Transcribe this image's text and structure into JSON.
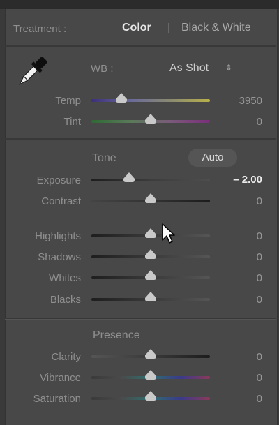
{
  "treatment": {
    "label": "Treatment :",
    "color": "Color",
    "separator": "|",
    "bw": "Black & White"
  },
  "wb": {
    "label": "WB :",
    "value": "As Shot",
    "arrow": "⇕",
    "picker_icon": "eyedropper-icon"
  },
  "temp": {
    "label": "Temp",
    "value": "3950",
    "position": 0.25
  },
  "tint": {
    "label": "Tint",
    "value": "0",
    "position": 0.5
  },
  "tone": {
    "label": "Tone",
    "auto": "Auto"
  },
  "exposure": {
    "label": "Exposure",
    "value": "– 2.00",
    "position": 0.32
  },
  "contrast": {
    "label": "Contrast",
    "value": "0",
    "position": 0.5
  },
  "highlights": {
    "label": "Highlights",
    "value": "0",
    "position": 0.5
  },
  "shadows": {
    "label": "Shadows",
    "value": "0",
    "position": 0.5
  },
  "whites": {
    "label": "Whites",
    "value": "0",
    "position": 0.5
  },
  "blacks": {
    "label": "Blacks",
    "value": "0",
    "position": 0.5
  },
  "presence": {
    "label": "Presence"
  },
  "clarity": {
    "label": "Clarity",
    "value": "0",
    "position": 0.5
  },
  "vibrance": {
    "label": "Vibrance",
    "value": "0",
    "position": 0.5
  },
  "saturation": {
    "label": "Saturation",
    "value": "0",
    "position": 0.5
  },
  "colors": {
    "active": "#e6e6e6",
    "label": "#8f8f8f",
    "panel": "#484848"
  }
}
